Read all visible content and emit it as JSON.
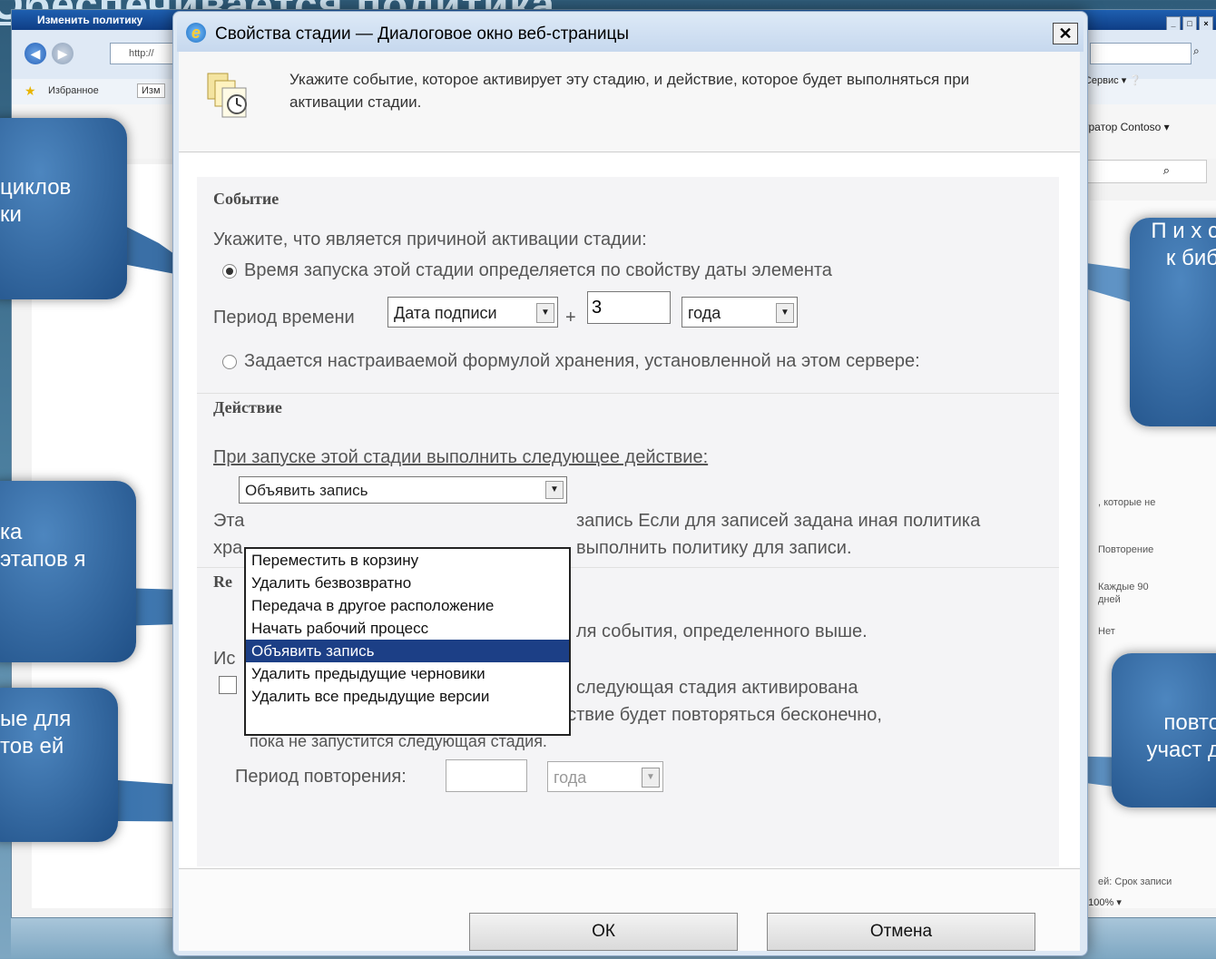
{
  "slide": {
    "title": "Обеспечивается политика"
  },
  "browser": {
    "window_title": "Изменить политику",
    "address": "http://",
    "favorites_label": "Избранное",
    "favorites_tab": "Изм",
    "tools_menu": "Сервис",
    "user_label": "стратор Contoso",
    "right_note1": ", которые не",
    "right_repeat_header": "Повторение",
    "right_repeat_value1": "Каждые 90 дней",
    "right_repeat_value2": "Нет",
    "right_bottom": "ей: Срок записи",
    "zoom": "100%"
  },
  "callouts": [
    {
      "text": "циклов ки"
    },
    {
      "text": "ка этапов я"
    },
    {
      "text": "ые для тов ей"
    },
    {
      "text": "П и х с к биб"
    },
    {
      "text": "повто участ д"
    }
  ],
  "dialog": {
    "title": "Свойства стадии — Диалоговое окно веб-страницы",
    "close_label": "✕",
    "description": "Укажите событие, которое активирует эту стадию, и действие, которое будет выполняться при активации стадии.",
    "event": {
      "heading": "Событие",
      "prompt": "Укажите, что является причиной активации стадии:",
      "option_date": "Время запуска этой стадии определяется по свойству даты элемента",
      "period_label": "Период времени",
      "date_field": "Дата подписи",
      "plus": "+",
      "amount": "3",
      "unit": "года",
      "option_formula": "Задается настраиваемой формулой хранения, установленной на этом сервере:"
    },
    "action": {
      "heading": "Действие",
      "prompt": "При запуске этой стадии выполнить следующее действие:",
      "selected": "Объявить запись",
      "options": [
        "Переместить в корзину",
        "Удалить безвозвратно",
        "Передача в другое расположение",
        "Начать рабочий процесс",
        "Объявить запись",
        "Удалить предыдущие черновики",
        "Удалить все предыдущие версии"
      ],
      "help_prefix1": "Эта",
      "help_suffix1": "запись Если для записей задана иная политика",
      "help_prefix2": "хра",
      "help_suffix2": "выполнить политику для записи."
    },
    "recurrence": {
      "heading_partial": "Re",
      "event_text": "ля события, определенного выше.",
      "prefix": "Ис",
      "checkbox_text": "следующая стадия активирована",
      "note_line1": "После первого запуска стадии ее действие будет повторяться бесконечно,",
      "note_line2": "пока не запустится следующая стадия.",
      "period_label": "Период повторения:",
      "period_value": "",
      "unit": "года"
    },
    "buttons": {
      "ok": "ОК",
      "cancel": "Отмена"
    }
  }
}
